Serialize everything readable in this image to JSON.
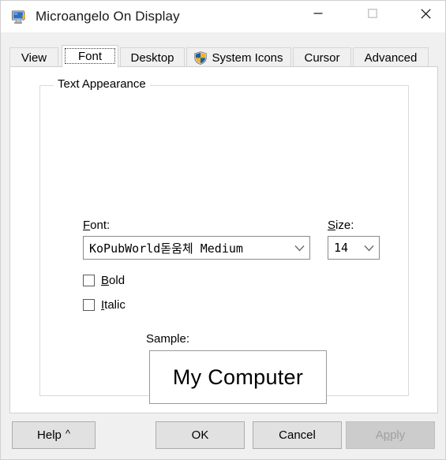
{
  "window": {
    "title": "Microangelo On Display",
    "icon": "monitor-icon",
    "controls": {
      "minimize": "minimize-icon",
      "maximize": "maximize-icon",
      "close": "close-icon"
    }
  },
  "tabs": [
    {
      "label": "View",
      "selected": false,
      "icon": null
    },
    {
      "label": "Font",
      "selected": true,
      "icon": null
    },
    {
      "label": "Desktop",
      "selected": false,
      "icon": null
    },
    {
      "label": "System Icons",
      "selected": false,
      "icon": "uac-shield-icon"
    },
    {
      "label": "Cursor",
      "selected": false,
      "icon": null
    },
    {
      "label": "Advanced",
      "selected": false,
      "icon": null
    }
  ],
  "font_page": {
    "group_title": "Text Appearance",
    "font": {
      "label": "Font:",
      "accelerator": "F",
      "value": "KoPubWorld돋움체 Medium",
      "dropdown_icon": "chevron-down-icon"
    },
    "size": {
      "label": "Size:",
      "accelerator": "S",
      "value": "14",
      "dropdown_icon": "chevron-down-icon"
    },
    "bold": {
      "label": "Bold",
      "accelerator": "B",
      "checked": false
    },
    "italic": {
      "label": "Italic",
      "accelerator": "I",
      "checked": false
    },
    "sample": {
      "label": "Sample:",
      "text": "My Computer"
    }
  },
  "buttons": {
    "help": {
      "label": "Help",
      "suffix": "^",
      "enabled": true
    },
    "ok": {
      "label": "OK",
      "enabled": true
    },
    "cancel": {
      "label": "Cancel",
      "enabled": true
    },
    "apply": {
      "label": "Apply",
      "accelerator": "p",
      "enabled": false
    }
  },
  "colors": {
    "dialog_background": "#f0f0f0",
    "page_background": "#ffffff",
    "button_face": "#e1e1e1",
    "disabled_button_face": "#cccccc",
    "disabled_text": "#a0a0a0",
    "border": "#d0d0d0",
    "shield_blue": "#1b5fa8",
    "shield_gold": "#f0b323"
  }
}
